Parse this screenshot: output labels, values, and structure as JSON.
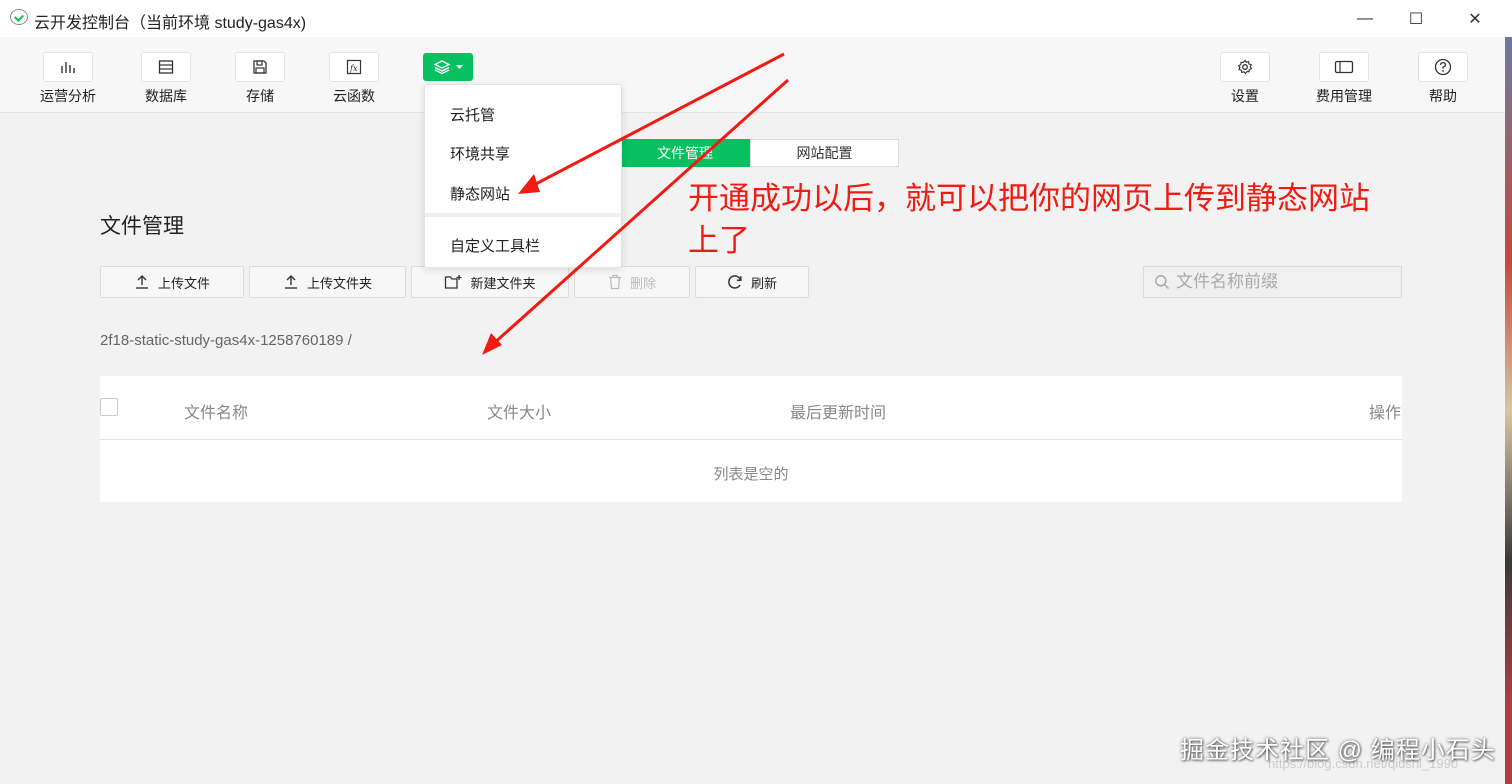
{
  "window": {
    "title": "云开发控制台（当前环境 study-gas4x)",
    "minimize": "—",
    "maximize": "☐",
    "close": "✕"
  },
  "toolbar": {
    "left_items": [
      {
        "label": "运营分析",
        "icon": "bar-chart-icon"
      },
      {
        "label": "数据库",
        "icon": "database-icon"
      },
      {
        "label": "存储",
        "icon": "storage-icon"
      },
      {
        "label": "云函数",
        "icon": "function-icon"
      }
    ],
    "more_button_icon": "layers-icon",
    "right_items": [
      {
        "label": "设置",
        "icon": "gear-icon"
      },
      {
        "label": "费用管理",
        "icon": "billing-icon"
      },
      {
        "label": "帮助",
        "icon": "help-icon"
      }
    ]
  },
  "dropdown": {
    "items": [
      "云托管",
      "环境共享",
      "静态网站"
    ],
    "footer_item": "自定义工具栏"
  },
  "tabs": {
    "active": "文件管理",
    "inactive": "网站配置"
  },
  "page": {
    "title": "文件管理",
    "buttons": {
      "upload_file": "上传文件",
      "upload_folder": "上传文件夹",
      "new_folder": "新建文件夹",
      "delete": "删除",
      "refresh": "刷新"
    },
    "search_placeholder": "文件名称前缀",
    "breadcrumb": "2f18-static-study-gas4x-1258760189  /"
  },
  "table": {
    "columns": [
      "文件名称",
      "文件大小",
      "最后更新时间",
      "操作"
    ],
    "empty_text": "列表是空的"
  },
  "annotation": {
    "text": "开通成功以后，就可以把你的网页上传到静态网站上了"
  },
  "watermark": {
    "text": "掘金技术社区 @ 编程小石头",
    "url": "https://blog.csdn.net/qiushi_1990"
  },
  "colors": {
    "accent_green": "#07c160",
    "annotation_red": "#f01b12"
  }
}
